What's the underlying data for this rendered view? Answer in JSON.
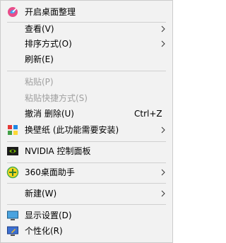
{
  "menu": {
    "items": [
      {
        "label": "开启桌面整理",
        "icon": "desktop-organize-icon"
      },
      {
        "label": "查看(V)",
        "arrow": "chevron-right-icon"
      },
      {
        "label": "排序方式(O)",
        "arrow": "chevron-right-icon"
      },
      {
        "label": "刷新(E)"
      },
      {
        "label": "粘贴(P)",
        "disabled": true
      },
      {
        "label": "粘贴快捷方式(S)",
        "disabled": true
      },
      {
        "label": "撤消 删除(U)",
        "shortcut": "Ctrl+Z"
      },
      {
        "label": "换壁纸 (此功能需要安装)",
        "icon": "wallpaper-icon",
        "arrow": "chevron-right-icon"
      },
      {
        "label": "NVIDIA 控制面板",
        "icon": "nvidia-icon"
      },
      {
        "label": "360桌面助手",
        "icon": "desktop-assistant-360-icon",
        "arrow": "chevron-right-icon"
      },
      {
        "label": "新建(W)",
        "arrow": "chevron-right-icon"
      },
      {
        "label": "显示设置(D)",
        "icon": "display-settings-icon"
      },
      {
        "label": "个性化(R)",
        "icon": "personalize-icon"
      }
    ]
  }
}
